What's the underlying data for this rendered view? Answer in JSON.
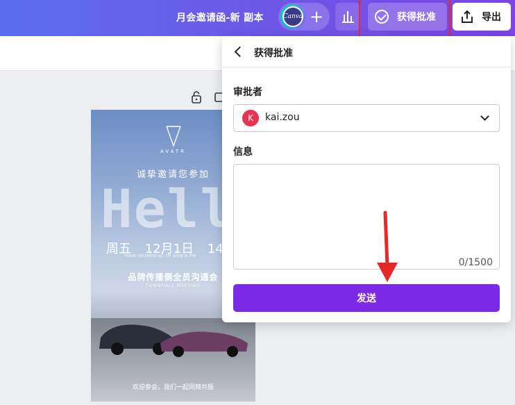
{
  "topbar": {
    "doc_title": "月会邀请函-新 副本",
    "canva_label": "Canva",
    "plus_label": "+",
    "approval_label": "获得批准",
    "export_label": "导出"
  },
  "design": {
    "brand": "AVATR",
    "invite": "诚挚邀请您参加",
    "hello": "Hello",
    "dates": [
      "周五",
      "12月1日",
      "14"
    ],
    "dates_sub": "FRIDAY  DECEMBER   A区 10F 会议室   IN THE",
    "event": "品牌传播侧全员沟通会",
    "event_sub": "TOWNHALL MEETING",
    "footer": "欢迎参会，我们一起同频共振"
  },
  "panel": {
    "title": "获得批准",
    "approver_label": "审批者",
    "approver_initial": "K",
    "approver_name": "kai.zou",
    "message_label": "信息",
    "message_value": "",
    "counter": "0/1500",
    "send_label": "发送"
  },
  "colors": {
    "accent": "#7d2ae8",
    "annotation": "#e62828",
    "avatar": "#e8344e"
  }
}
